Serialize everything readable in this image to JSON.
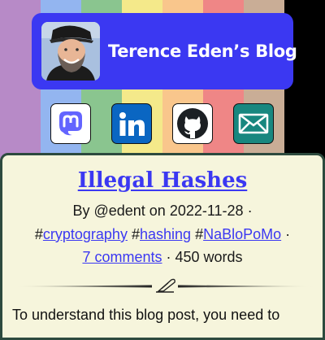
{
  "colors": {
    "stripes": [
      "#b78ac7",
      "#93b5f0",
      "#8ac58f",
      "#f4e98a",
      "#f9c68c",
      "#ef8686",
      "#c9ad96",
      "#000000"
    ],
    "header_bg": "#3b38f2",
    "card_bg": "#f6f5dc",
    "card_border": "#2d4a3e",
    "link": "#3b38f2"
  },
  "header": {
    "title": "Terence Eden’s Blog",
    "avatar_icon": "bearded-man-in-cap-photo"
  },
  "socials": [
    {
      "name": "mastodon",
      "icon": "mastodon-icon",
      "bg": "#ffffff"
    },
    {
      "name": "linkedin",
      "icon": "linkedin-icon",
      "bg": "#0a66c2"
    },
    {
      "name": "github",
      "icon": "github-icon",
      "bg": "#ffffff"
    },
    {
      "name": "email",
      "icon": "email-icon",
      "bg": "#18877f"
    }
  ],
  "post": {
    "title": "Illegal Hashes",
    "by_prefix": "By ",
    "author": "@edent",
    "on_text": " on ",
    "date": "2022-11-28",
    "sep": " ·",
    "hash": "#",
    "tags": [
      "cryptography",
      "hashing",
      "NaBloPoMo"
    ],
    "comments": "7 comments",
    "words": " · 450 words",
    "divider_icon": "quill-pen-icon",
    "intro": "To understand this blog post, you need to"
  }
}
